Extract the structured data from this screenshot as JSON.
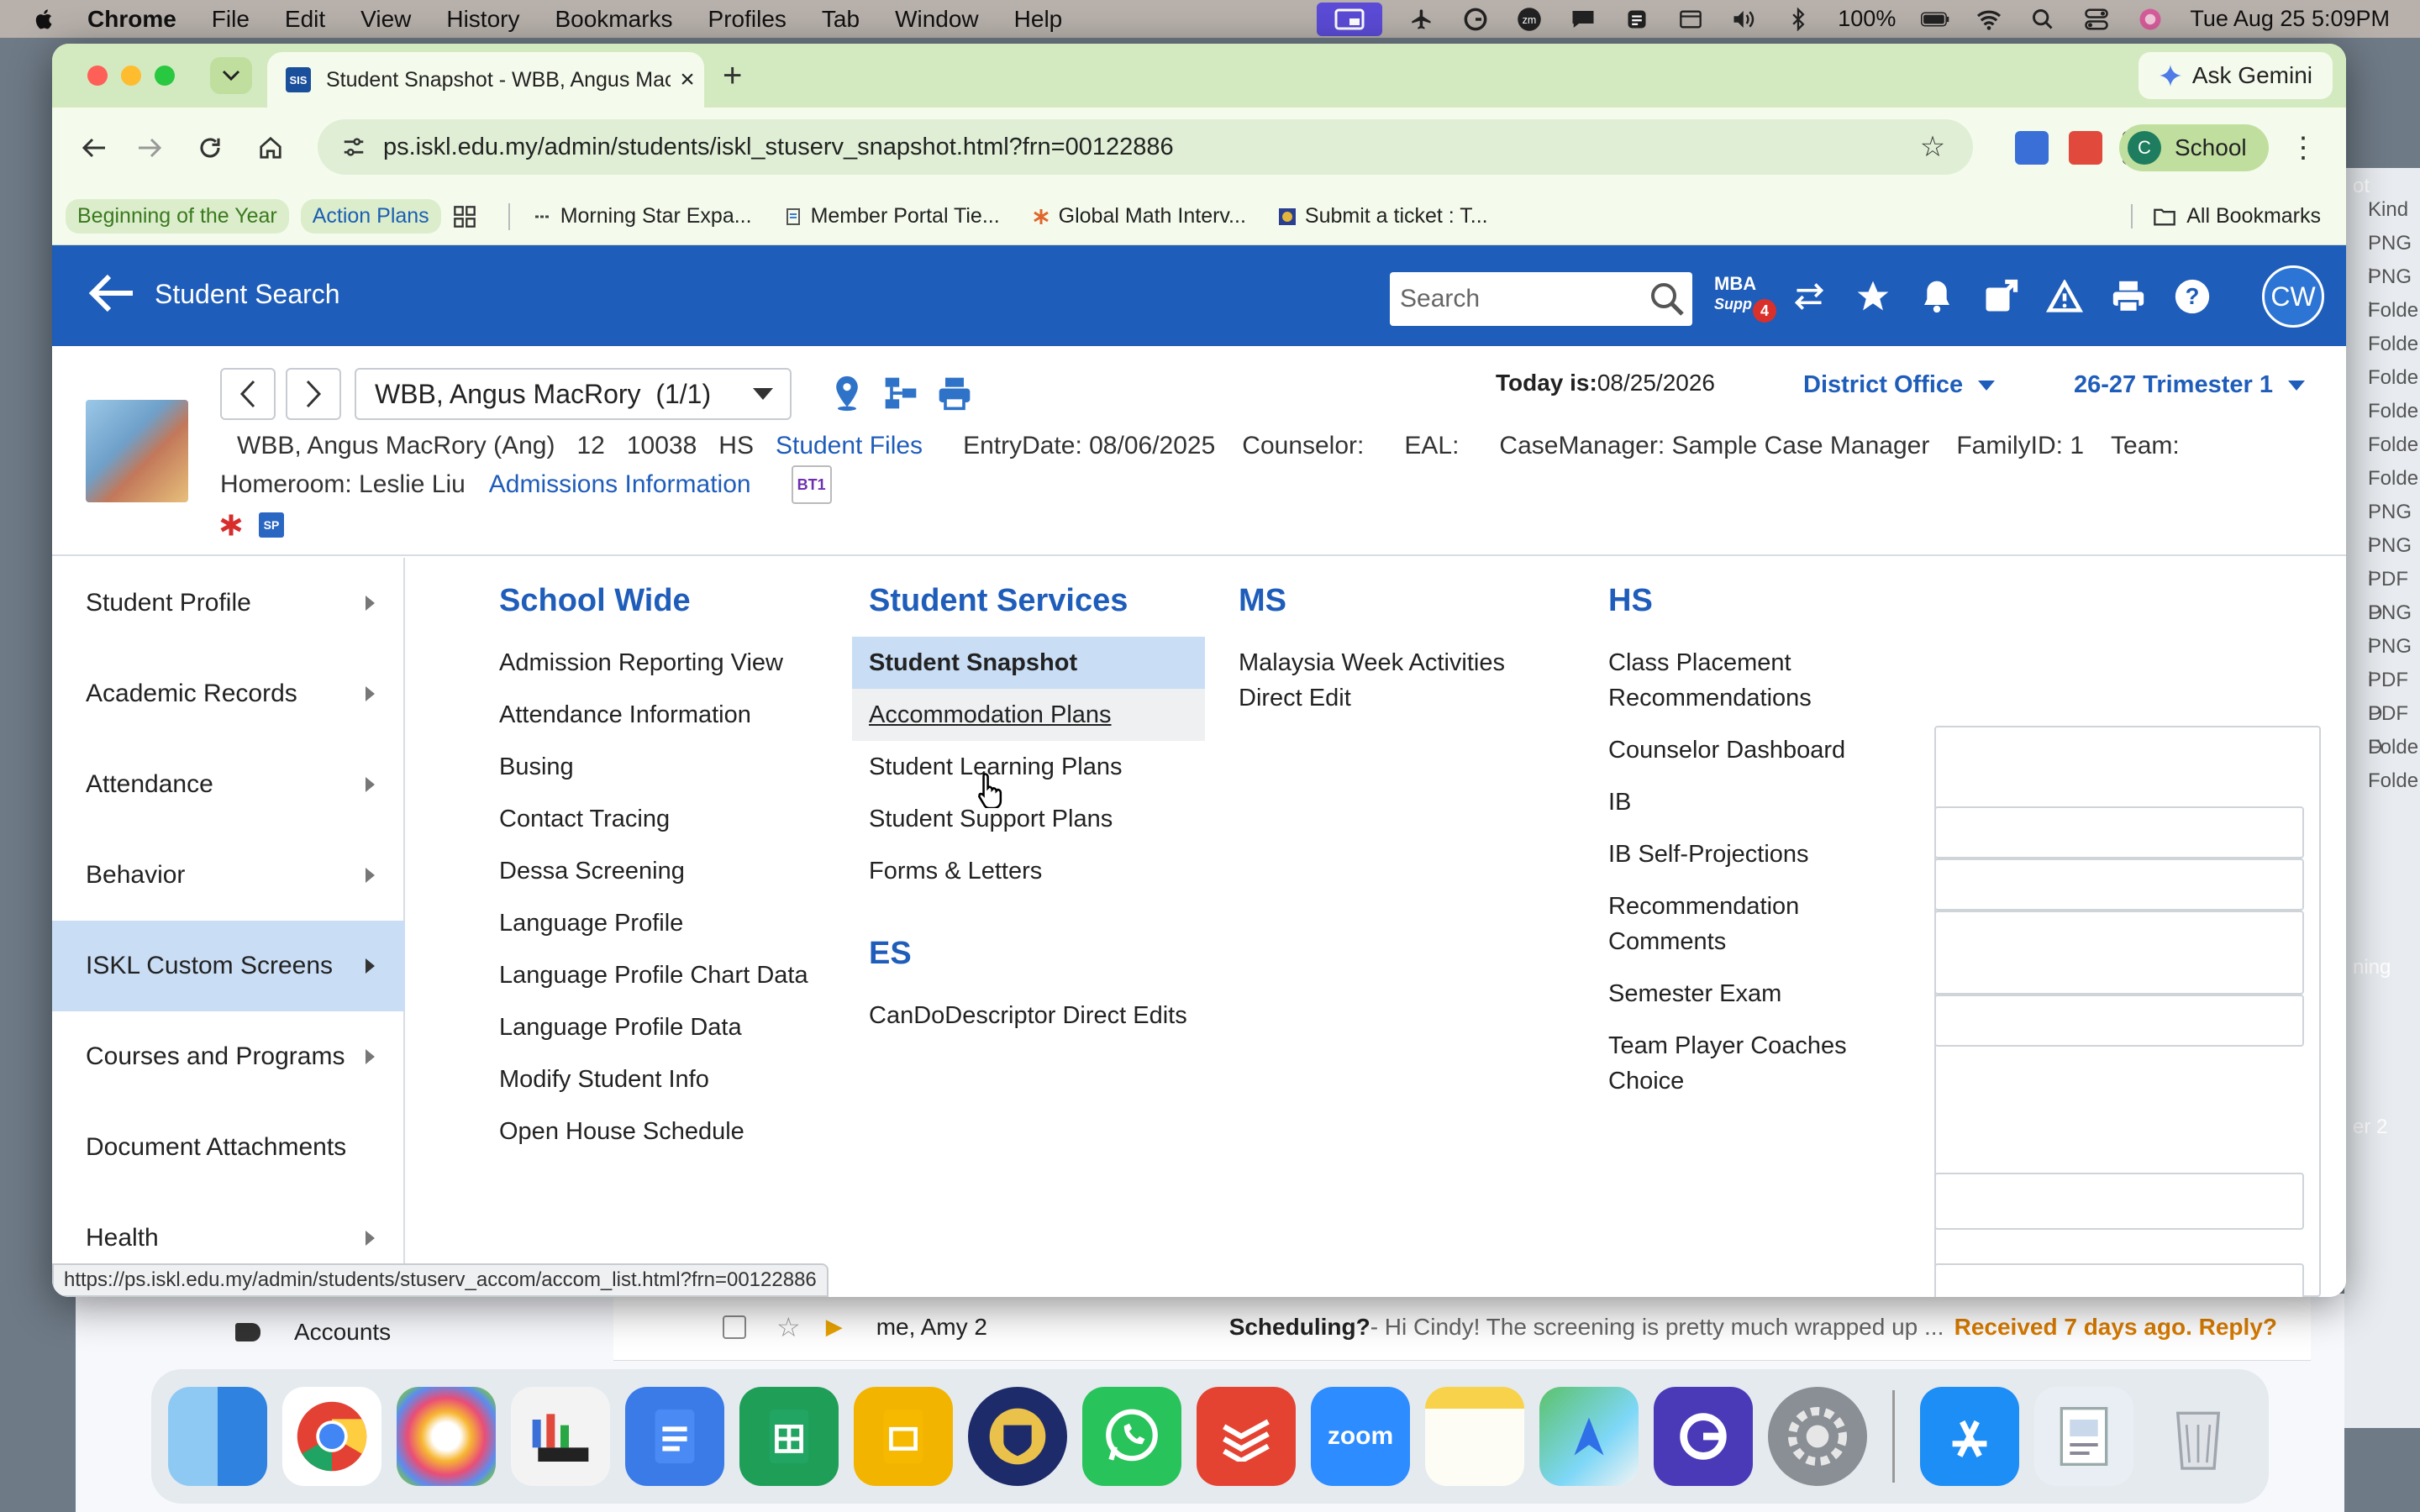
{
  "menubar": {
    "app": "Chrome",
    "items": [
      "File",
      "Edit",
      "View",
      "History",
      "Bookmarks",
      "Profiles",
      "Tab",
      "Window",
      "Help"
    ],
    "battery": "100%",
    "datetime": "Tue Aug 25  5:09PM"
  },
  "browser": {
    "tab_title": "Student Snapshot - WBB, Angus MacRory",
    "gemini": "Ask Gemini",
    "url": "ps.iskl.edu.my/admin/students/iskl_stuserv_snapshot.html?frn=00122886",
    "profile_initial": "C",
    "profile_name": "School",
    "bookmarks": [
      "Beginning of the Year",
      "Action Plans",
      "Morning Star Expa...",
      "Member Portal Tie...",
      "Global Math Interv...",
      "Submit a ticket : T..."
    ],
    "all_bookmarks": "All Bookmarks",
    "status_url": "https://ps.iskl.edu.my/admin/students/stuserv_accom/accom_list.html?frn=00122886"
  },
  "header": {
    "back_label": "Student Search",
    "search_placeholder": "Search",
    "mba_line1": "MBA",
    "mba_line2": "Supp",
    "mba_badge": "4",
    "user_initials": "CW"
  },
  "student": {
    "selector": "WBB, Angus MacRory  (1/1)",
    "today_label": "Today is:",
    "today_value": "08/25/2026",
    "district": "District Office",
    "term": "26-27 Trimester 1",
    "name": "WBB, Angus MacRory (Ang)",
    "grade": "12",
    "id": "10038",
    "school": "HS",
    "files_link": "Student Files",
    "entry_date": "EntryDate: 08/06/2025",
    "counselor": "Counselor:",
    "eal": "EAL:",
    "case_manager": "CaseManager: Sample Case Manager",
    "family_id": "FamilyID: 1",
    "team": "Team:",
    "homeroom": "Homeroom: Leslie Liu",
    "admissions_link": "Admissions Information",
    "bt1": "BT1",
    "sp": "SP"
  },
  "leftnav": [
    "Student Profile",
    "Academic Records",
    "Attendance",
    "Behavior",
    "ISKL Custom Screens",
    "Courses and Programs",
    "Document Attachments",
    "Health"
  ],
  "menu": {
    "school_wide": {
      "title": "School Wide",
      "items": [
        "Admission Reporting View",
        "Attendance Information",
        "Busing",
        "Contact Tracing",
        "Dessa Screening",
        "Language Profile",
        "Language Profile Chart Data",
        "Language Profile Data",
        "Modify Student Info",
        "Open House Schedule"
      ]
    },
    "student_services": {
      "title": "Student Services",
      "items": [
        "Student Snapshot",
        "Accommodation Plans",
        "Student Learning Plans",
        "Student Support Plans",
        "Forms & Letters"
      ]
    },
    "es": {
      "title": "ES",
      "items": [
        "CanDoDescriptor Direct Edits"
      ]
    },
    "ms": {
      "title": "MS",
      "items": [
        "Malaysia Week Activities Direct Edit"
      ]
    },
    "hs": {
      "title": "HS",
      "items": [
        "Class Placement Recommendations",
        "Counselor Dashboard",
        "IB",
        "IB Self-Projections",
        "Recommendation Comments",
        "Semester Exam",
        "Team Player Coaches Choice"
      ]
    }
  },
  "background": {
    "accounts_label": "Accounts",
    "mail_from": "me, Amy 2",
    "mail_subject": "Scheduling?",
    "mail_snippet": " - Hi Cindy! The screening is pretty much wrapped up ...",
    "mail_received": "Received 7 days ago. Reply?",
    "side_text_1": "ot",
    "side_text_2": "ning",
    "side_text_3": "er 2",
    "side_kind": "Kind",
    "side_items": [
      "PNG i",
      "PNG i",
      "Folde",
      "Folde",
      "Folde",
      "Folde",
      "Folde",
      "Folde",
      "PNG i",
      "PNG i",
      "PDF D",
      "PNG i",
      "PNG i",
      "PDF D",
      "PDF D",
      "Folde",
      "Folde"
    ]
  },
  "dock": {
    "zoom_label": "zoom"
  },
  "colors": {
    "ps_blue": "#1f5dba",
    "selected_bg": "#c9ddf5",
    "chrome_green": "#d3eac0"
  }
}
